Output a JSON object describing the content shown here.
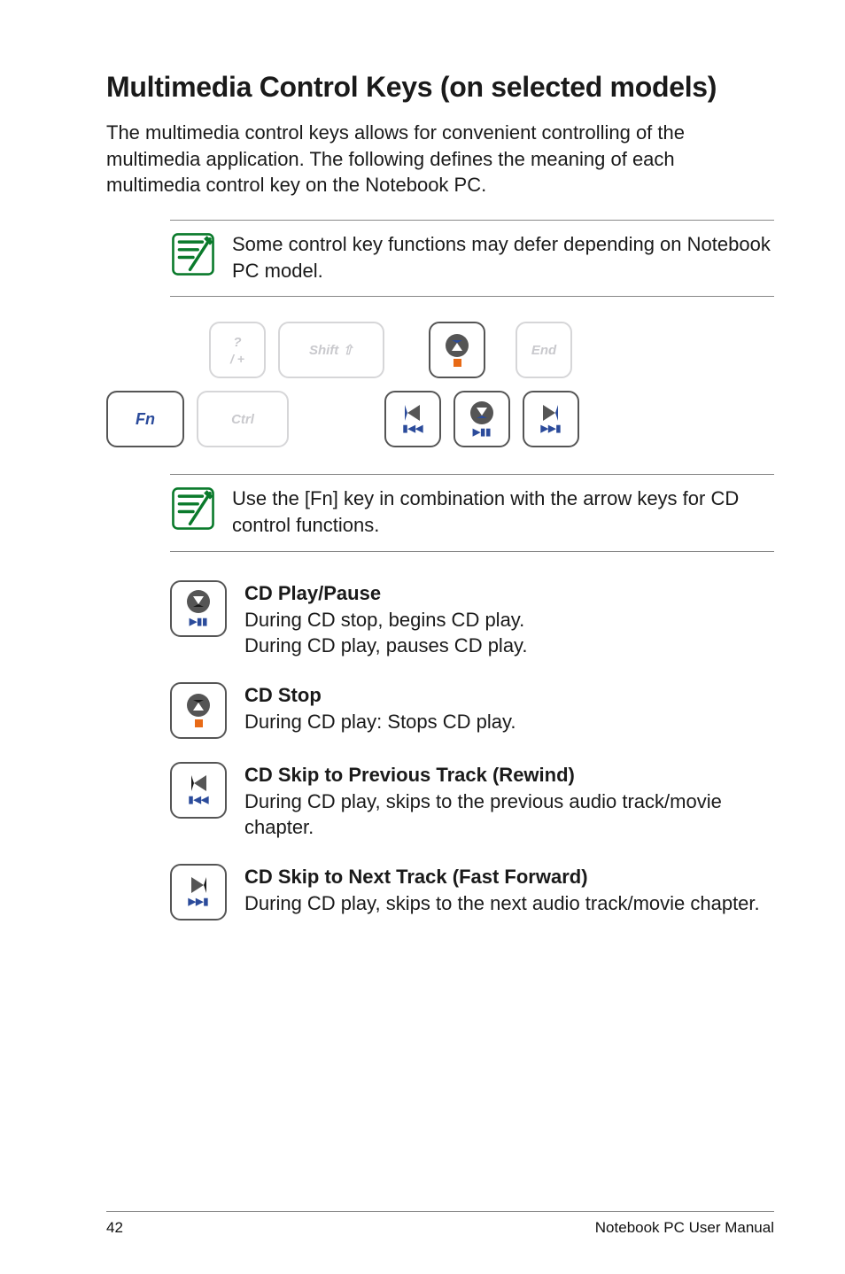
{
  "heading": "Multimedia Control Keys (on selected models)",
  "intro": "The multimedia control keys allows for convenient controlling of the multimedia application. The following defines the meaning of each multimedia control key on the Notebook PC.",
  "note1": "Some control key functions may defer depending on Notebook PC model.",
  "keyboard": {
    "fn": "Fn",
    "slash_top": "?",
    "slash_bottom": "/   +",
    "shift": "Shift ⇧",
    "end": "End",
    "ctrl": "Ctrl",
    "rewind_glyph": "▮◀◀",
    "playpause_glyph": "▶▮▮",
    "next_glyph": "▶▶▮"
  },
  "note2": "Use the [Fn] key in combination with the arrow keys for CD control functions.",
  "defs": {
    "playpause": {
      "title": "CD Play/Pause",
      "line1": "During CD stop, begins CD play.",
      "line2": "During CD play, pauses CD play."
    },
    "stop": {
      "title": "CD Stop",
      "line1": "During CD play: Stops CD play."
    },
    "prev": {
      "title": "CD Skip to Previous Track (Rewind)",
      "line1": "During CD play, skips to the previous audio track/movie chapter."
    },
    "next": {
      "title": "CD Skip to Next Track (Fast Forward)",
      "line1": "During CD play, skips to the next audio track/movie chapter."
    }
  },
  "footer": {
    "page": "42",
    "title": "Notebook PC User Manual"
  }
}
